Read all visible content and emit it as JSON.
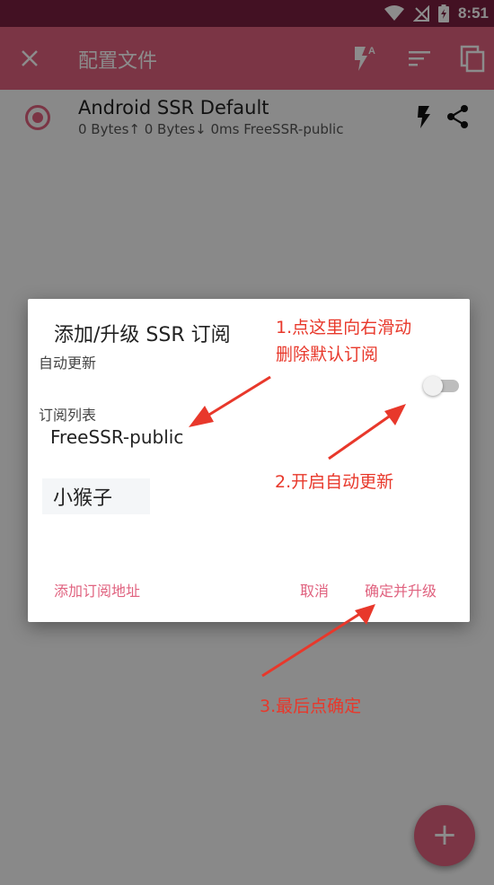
{
  "status_bar": {
    "time": "8:51",
    "icons": [
      "wifi-icon",
      "no-signal-icon",
      "battery-icon"
    ]
  },
  "app_bar": {
    "title": "配置文件",
    "icons": [
      "close-icon",
      "flash-auto-icon",
      "sort-icon",
      "copy-icon"
    ]
  },
  "profile": {
    "name": "Android SSR Default",
    "stats": "0 Bytes↑  0 Bytes↓  0ms FreeSSR-public",
    "icons": [
      "radio-selected-icon",
      "flash-icon",
      "share-icon"
    ]
  },
  "dialog": {
    "title": "添加/升级 SSR 订阅",
    "auto_update_label": "自动更新",
    "auto_update_on": false,
    "list_label": "订阅列表",
    "subscriptions": [
      "FreeSSR-public",
      "小猴子"
    ],
    "add_button": "添加订阅地址",
    "cancel_button": "取消",
    "confirm_button": "确定并升级"
  },
  "annotations": {
    "step1_line1": "1.点这里向右滑动",
    "step1_line2": "删除默认订阅",
    "step2": "2.开启自动更新",
    "step3": "3.最后点确定",
    "color": "#e8382b"
  },
  "fab": {
    "icon": "plus-icon",
    "label": "+"
  },
  "colors": {
    "primary": "#e0627f",
    "status_bar": "#7a1f40"
  }
}
